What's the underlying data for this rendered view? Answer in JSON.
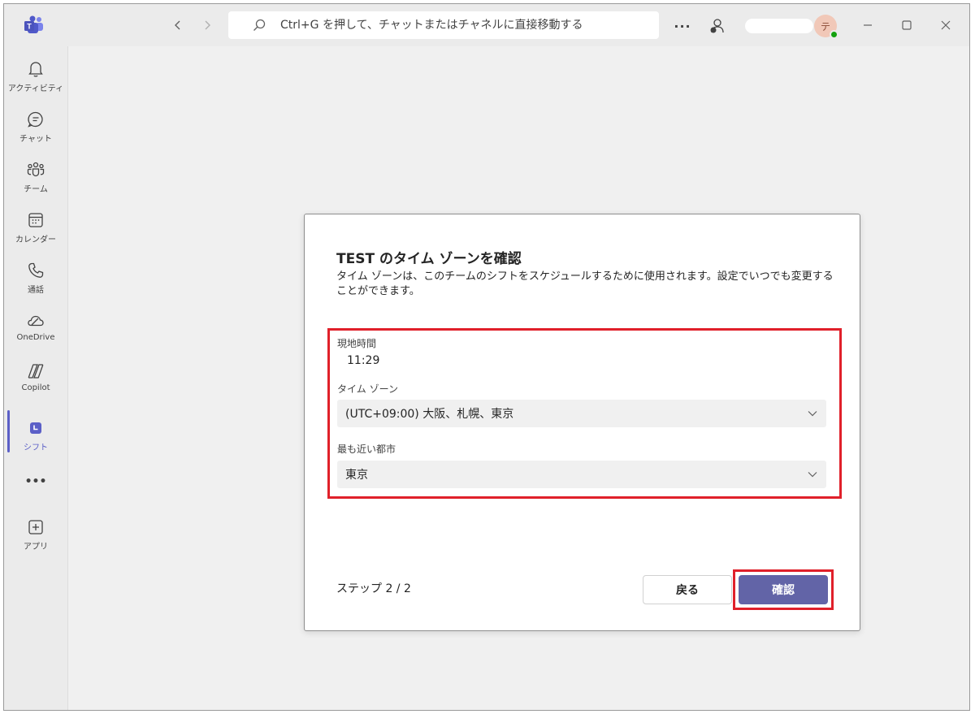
{
  "titlebar": {
    "search_placeholder": "Ctrl+G を押して、チャットまたはチャネルに直接移動する",
    "more_label": "···",
    "avatar_initial": "テ"
  },
  "rail": {
    "items": [
      {
        "label": "アクティビティ",
        "icon": "bell-icon"
      },
      {
        "label": "チャット",
        "icon": "chat-icon"
      },
      {
        "label": "チーム",
        "icon": "teams-icon"
      },
      {
        "label": "カレンダー",
        "icon": "calendar-icon"
      },
      {
        "label": "通話",
        "icon": "phone-icon"
      },
      {
        "label": "OneDrive",
        "icon": "onedrive-icon"
      },
      {
        "label": "Copilot",
        "icon": "copilot-icon"
      },
      {
        "label": "シフト",
        "icon": "shifts-icon"
      },
      {
        "label": "•••",
        "icon": "more-icon"
      },
      {
        "label": "アプリ",
        "icon": "apps-icon"
      }
    ]
  },
  "dialog": {
    "title": "TEST のタイム ゾーンを確認",
    "description": "タイム ゾーンは、このチームのシフトをスケジュールするために使用されます。設定でいつでも変更することができます。",
    "local_time_label": "現地時間",
    "local_time_value": "11:29",
    "timezone_label": "タイム ゾーン",
    "timezone_value": "(UTC+09:00) 大阪、札幌、東京",
    "city_label": "最も近い都市",
    "city_value": "東京",
    "step_text": "ステップ 2 / 2",
    "back_label": "戻る",
    "confirm_label": "確認"
  },
  "colors": {
    "accent": "#6264a7",
    "highlight": "#e0202a",
    "presence": "#13a10e"
  }
}
